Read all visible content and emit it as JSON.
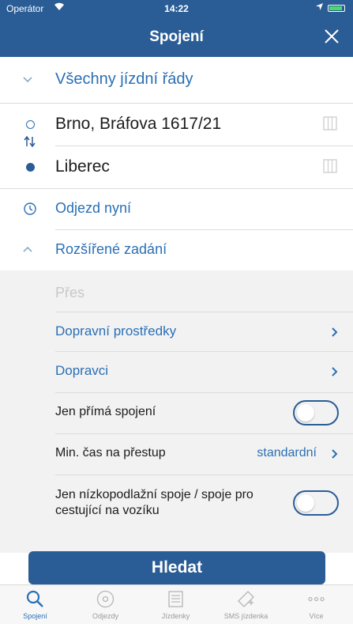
{
  "status_bar": {
    "carrier": "Operátor",
    "time": "14:22"
  },
  "nav": {
    "title": "Spojení"
  },
  "timetables": {
    "label": "Všechny jízdní řády"
  },
  "route": {
    "from": "Brno, Bráfova 1617/21",
    "to": "Liberec"
  },
  "departure": {
    "label": "Odjezd nyní"
  },
  "advanced": {
    "label": "Rozšířené zadání",
    "via_placeholder": "Přes",
    "transport_label": "Dopravní prostředky",
    "carriers_label": "Dopravci",
    "direct_label": "Jen přímá spojení",
    "direct_on": false,
    "transfer_label": "Min. čas na přestup",
    "transfer_value": "standardní",
    "lowfloor_label": "Jen nízkopodlažní spoje / spoje pro cestující na vozíku",
    "lowfloor_on": false
  },
  "search_button": "Hledat",
  "tabs": [
    {
      "label": "Spojení",
      "icon": "search-icon",
      "active": true
    },
    {
      "label": "Odjezdy",
      "icon": "departures-icon",
      "active": false
    },
    {
      "label": "Jízdenky",
      "icon": "tickets-icon",
      "active": false
    },
    {
      "label": "SMS jízdenka",
      "icon": "sms-ticket-icon",
      "active": false
    },
    {
      "label": "Více",
      "icon": "more-icon",
      "active": false
    }
  ],
  "colors": {
    "primary": "#2a5d96",
    "link": "#2a6fb5",
    "section_bg": "#f2f2f2"
  }
}
